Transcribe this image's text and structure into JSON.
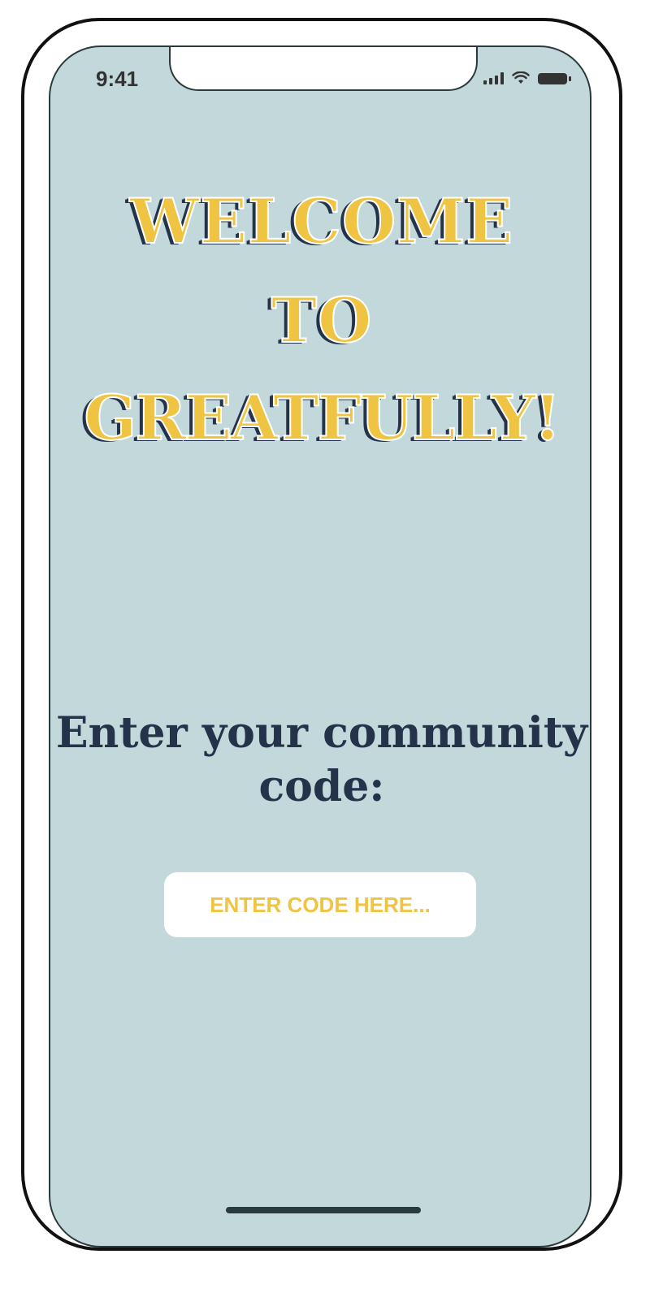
{
  "status_bar": {
    "time": "9:41",
    "icons": [
      "signal-icon",
      "wifi-icon",
      "battery-icon"
    ]
  },
  "welcome": {
    "line1": "WELCOME",
    "line2": "TO",
    "line3": "GREATFULLY!"
  },
  "prompt": {
    "line1": "Enter your community",
    "line2": "code:"
  },
  "code_input": {
    "placeholder": "ENTER CODE HERE...",
    "value": ""
  },
  "colors": {
    "background": "#c2d8da",
    "accent_yellow": "#f0c443",
    "navy": "#24324a"
  }
}
